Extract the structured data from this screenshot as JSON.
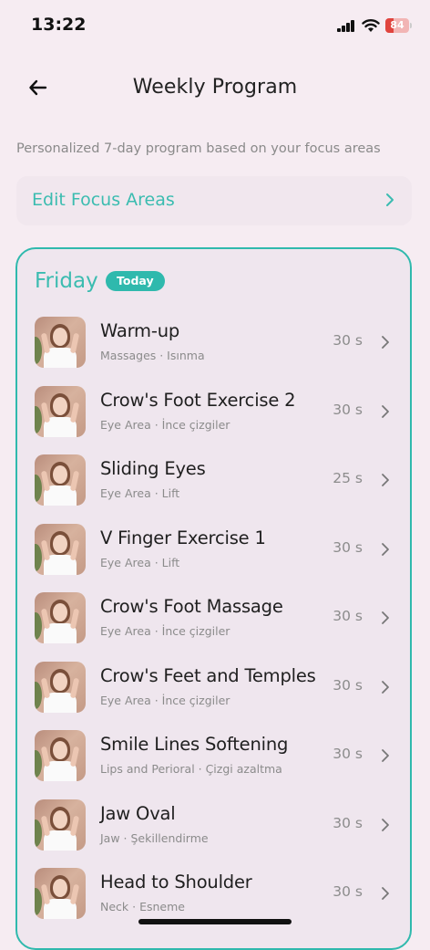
{
  "status_bar": {
    "time": "13:22",
    "battery": "84"
  },
  "header": {
    "title": "Weekly Program",
    "back_icon": "arrow-left-icon"
  },
  "subtitle": "Personalized 7-day program based on your focus areas",
  "edit_focus": {
    "label": "Edit Focus Areas"
  },
  "day": {
    "name": "Friday",
    "badge": "Today",
    "exercises": [
      {
        "name": "Warm-up",
        "meta": "Massages · Isınma",
        "duration": "30 s"
      },
      {
        "name": "Crow's Foot Exercise 2",
        "meta": "Eye Area · İnce çizgiler",
        "duration": "30 s"
      },
      {
        "name": "Sliding Eyes",
        "meta": "Eye Area · Lift",
        "duration": "25 s"
      },
      {
        "name": "V Finger Exercise 1",
        "meta": "Eye Area · Lift",
        "duration": "30 s"
      },
      {
        "name": "Crow's Foot Massage",
        "meta": "Eye Area · İnce çizgiler",
        "duration": "30 s"
      },
      {
        "name": "Crow's Feet and Temples",
        "meta": "Eye Area · İnce çizgiler",
        "duration": "30 s"
      },
      {
        "name": "Smile Lines Softening",
        "meta": "Lips and Perioral · Çizgi azaltma",
        "duration": "30 s"
      },
      {
        "name": "Jaw Oval",
        "meta": "Jaw · Şekillendirme",
        "duration": "30 s"
      },
      {
        "name": "Head to Shoulder",
        "meta": "Neck · Esneme",
        "duration": "30 s"
      }
    ]
  },
  "colors": {
    "accent": "#2fb9ad",
    "background": "#f6ecf2"
  }
}
